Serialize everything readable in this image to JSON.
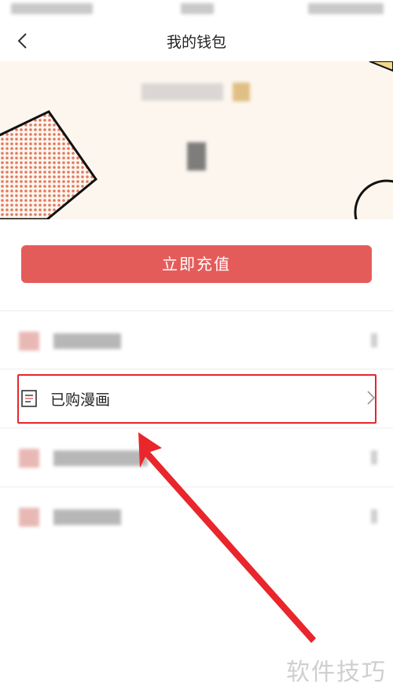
{
  "nav": {
    "title": "我的钱包",
    "back_icon": "chevron-left-icon"
  },
  "wallet": {
    "recharge_label": "立即充值"
  },
  "menu": {
    "purchased_label": "已购漫画",
    "purchased_icon": "list-document-icon",
    "arrow_icon": "chevron-right-icon"
  },
  "annotation": {
    "color": "#e8262c"
  },
  "colors": {
    "accent": "#e45c5a",
    "banner_bg": "#fcf6ef"
  },
  "watermark": {
    "text": "软件技巧"
  }
}
